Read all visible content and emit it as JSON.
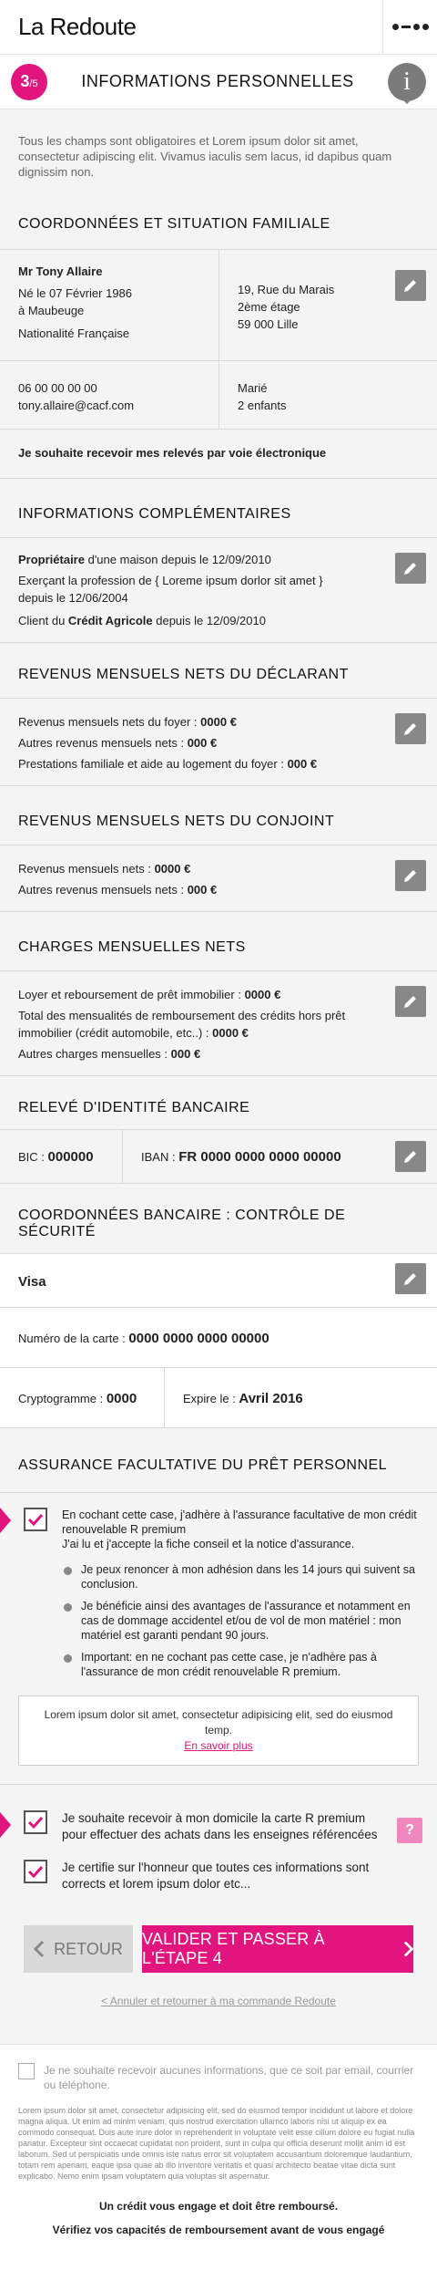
{
  "header": {
    "logo": "La Redoute",
    "menu_icon": "menu-dots-icon"
  },
  "step": {
    "current": "3",
    "total": "/5",
    "title": "INFORMATIONS PERSONNELLES"
  },
  "intro": "Tous les champs sont obligatoires et Lorem ipsum dolor sit amet, consectetur adipiscing elit. Vivamus iaculis sem lacus, id dapibus quam dignissim non.",
  "coordonnees": {
    "title": "COORDONNÉES ET SITUATION FAMILIALE",
    "name": "Mr Tony Allaire",
    "birth1": "Né le 07 Février 1986",
    "birth2": "à Maubeuge",
    "nationality": "Nationalité Française",
    "address1": "19, Rue du Marais",
    "address2": "2ème étage",
    "address3": "59 000 Lille",
    "phone": "06 00 00 00 00",
    "email": "tony.allaire@cacf.com",
    "status": "Marié",
    "children": "2 enfants",
    "releves": "Je souhaite recevoir mes relevés par voie électronique"
  },
  "complementaires": {
    "title": "INFORMATIONS COMPLÉMENTAIRES",
    "l1_bold": "Propriétaire",
    "l1_rest": " d'une maison depuis le 12/09/2010",
    "l2": "Exerçant la profession de  { Loreme ipsum dorlor sit amet }",
    "l3": "depuis le 12/06/2004",
    "l4_pre": "Client du ",
    "l4_bold": "Crédit Agricole",
    "l4_post": " depuis le 12/09/2010"
  },
  "revenus_declarant": {
    "title": "REVENUS MENSUELS NETS DU DÉCLARANT",
    "r1_label": "Revenus mensuels nets du foyer : ",
    "r1_value": "0000 €",
    "r2_label": "Autres revenus mensuels nets : ",
    "r2_value": "000 €",
    "r3_label": "Prestations familiale et aide au logement du foyer : ",
    "r3_value": "000 €"
  },
  "revenus_conjoint": {
    "title": "REVENUS MENSUELS NETS DU CONJOINT",
    "r1_label": "Revenus mensuels nets : ",
    "r1_value": "0000 €",
    "r2_label": "Autres revenus mensuels nets : ",
    "r2_value": "000 €"
  },
  "charges": {
    "title": "CHARGES MENSUELLES NETS",
    "c1_label": "Loyer et reboursement de prêt immobilier : ",
    "c1_value": "0000 €",
    "c2_label_a": "Total des mensualités de remboursement des crédits hors prêt",
    "c2_label_b": "immobilier (crédit automobile, etc..)  : ",
    "c2_value": "0000 €",
    "c3_label": "Autres charges mensuelles : ",
    "c3_value": "000 €"
  },
  "rib": {
    "title": "RELEVÉ D'IDENTITÉ BANCAIRE",
    "bic_label": "BIC : ",
    "bic_value": "000000",
    "iban_label": "IBAN : ",
    "iban_value": "FR 0000 0000 0000 00000"
  },
  "bancaire": {
    "title": "COORDONNÉES BANCAIRE : CONTRÔLE DE SÉCURITÉ",
    "card_type": "Visa",
    "card_label": "Numéro de la carte : ",
    "card_value": "0000 0000 0000 00000",
    "crypto_label": "Cryptogramme : ",
    "crypto_value": "0000",
    "expire_label": "Expire le : ",
    "expire_value": "Avril 2016"
  },
  "assurance": {
    "title": "ASSURANCE FACULTATIVE DU PRÊT PERSONNEL",
    "main_text": "En cochant cette case, j'adhère à l'assurance facultative de mon crédit renouvelable R premium",
    "main_text2": "J'ai lu et j'accepte la fiche conseil et la notice d'assurance.",
    "bullets": [
      "Je peux renoncer à mon adhésion dans les 14 jours qui suivent sa conclusion.",
      "Je bénéficie ainsi des avantages de l'assurance et notamment en cas de dommage accidentel et/ou de vol de mon matériel : mon matériel est garanti pendant 90 jours.",
      "Important: en ne cochant pas cette case, je n'adhère pas à l'assurance de mon crédit renouvelable R premium."
    ],
    "box_text": "Lorem ipsum dolor sit amet, consectetur adipisicing elit, sed do eiusmod temp.",
    "box_link": "En savoir plus"
  },
  "options": {
    "carte_text": "Je souhaite recevoir à mon domicile la carte R premium pour effectuer des achats dans les enseignes référencées",
    "help": "?",
    "certify_text": "Je certifie sur l'honneur que toutes ces informations sont corrects et lorem ipsum dolor etc..."
  },
  "buttons": {
    "back": "RETOUR",
    "next": "VALIDER ET PASSER À L'ÉTAPE 4"
  },
  "cancel_link": "< Annuler et retourner à ma commande Redoute",
  "optout": "Je ne souhaite recevoir aucunes informations, que ce soit par email, courrier ou téléphone.",
  "legal": "Lorem ipsum dolor sit amet, consectetur adipisicing elit, sed do eiusmod tempor incididunt ut labore et dolore magna aliqua. Ut enim ad minim veniam, quis nostrud exercitation ullamco laboris nisi ut aliquip ex ea commodo consequat. Duis aute irure dolor in reprehenderit in voluptate velit esse cillum dolore eu fugiat nulla pariatur. Excepteur sint occaecat cupidatat non proident, sunt in culpa qui officia deserunt mollit anim id est laborum. Sed ut perspiciatis unde omnis iste natus error sit voluptatem accusantium doloremque laudantium, totam rem aperiam, eaque ipsa quae ab illo inventore veritatis et quasi architecto beatae vitae dicta sunt explicabo. Nemo enim ipsam voluptatem quia voluptas sit aspernatur.",
  "credit1": "Un crédit vous engage et doit être remboursé.",
  "credit2": "Vérifiez vos capacités de remboursement avant de vous engagé",
  "colors": {
    "accent": "#e2147d",
    "edit": "#888888"
  }
}
